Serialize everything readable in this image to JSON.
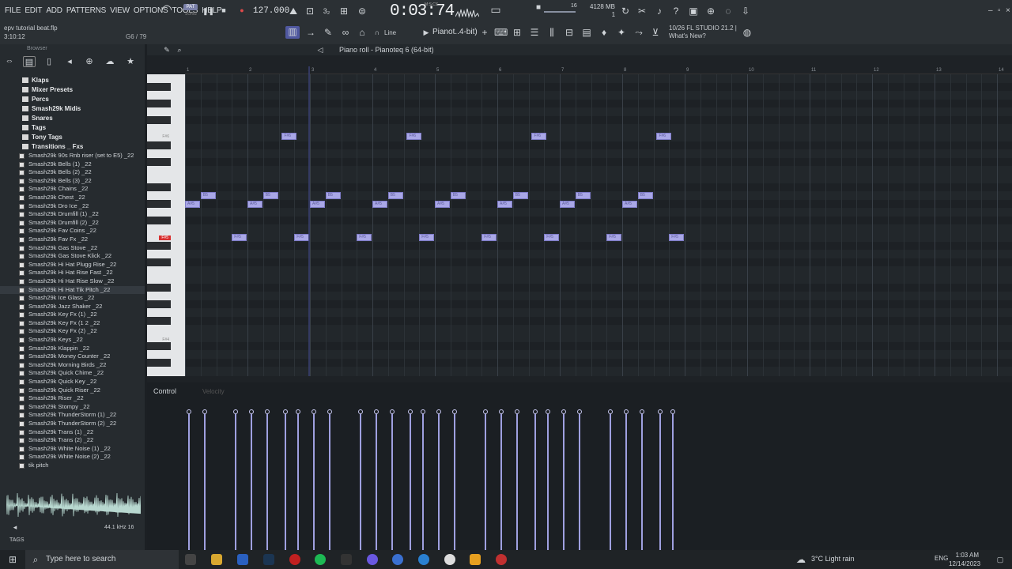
{
  "menu": {
    "items": [
      "FILE",
      "EDIT",
      "ADD",
      "PATTERNS",
      "VIEW",
      "OPTIONS",
      "TOOLS",
      "HELP"
    ]
  },
  "project": {
    "name": "epv tutorial beat.flp",
    "time": "3:10:12",
    "pattern": "G6 / 79"
  },
  "transport": {
    "mode_pat": "PAT",
    "mode_song": "SONG",
    "tempo": "127.000",
    "time": "0:03:74",
    "time_unit": "M:S:CS",
    "step": "3₂"
  },
  "cpu": {
    "memory": "4128 MB",
    "poly": "16",
    "cpu_val": "1"
  },
  "news": {
    "line1": "10/26  FL STUDIO 21.2 |",
    "line2": "What's New?"
  },
  "toolbar": {
    "snap": "Line",
    "channel": "Pianot..4-bit)"
  },
  "browser": {
    "title": "Browser",
    "folders": [
      "Klaps",
      "Mixer Presets",
      "Percs",
      "Smash29k Midis",
      "Snares",
      "Tags",
      "Tony Tags",
      "Transitions _ Fxs"
    ],
    "files": [
      "Smash29k 90s Rnb riser (set to E5) _22",
      "Smash29k Bells (1) _22",
      "Smash29k Bells (2) _22",
      "Smash29k Bells (3) _22",
      "Smash29k Chains _22",
      "Smash29k Chest _22",
      "Smash29k Dro Ice _22",
      "Smash29k Drumfill (1) _22",
      "Smash29k Drumfill (2) _22",
      "Smash29k Fav Coins _22",
      "Smash29k Fav Fx _22",
      "Smash29k Gas Stove _22",
      "Smash29k Gas Stove Klick _22",
      "Smash29k Hi Hat Plugg Rise _22",
      "Smash29k Hi Hat Rise Fast _22",
      "Smash29k Hi Hat Rise Slow _22",
      "Smash29k Hi Hat Tik Pitch _22",
      "Smash29k Ice Glass _22",
      "Smash29k Jazz Shaker _22",
      "Smash29k Key Fx (1) _22",
      "Smash29k Key Fx (1 2 _22",
      "Smash29k Key Fx (2) _22",
      "Smash29k Keys _22",
      "Smash29k Klappin _22",
      "Smash29k Money Counter _22",
      "Smash29k Morning Birds _22",
      "Smash29k Quick Chime _22",
      "Smash29k Quick Key _22",
      "Smash29k Quick Riser _22",
      "Smash29k Riser _22",
      "Smash29k Stompy _22",
      "Smash29k ThunderStorm (1) _22",
      "Smash29k ThunderStorm (2) _22",
      "Smash29k Trans (1) _22",
      "Smash29k Trans (2) _22",
      "Smash29k White Noise (1) _22",
      "Smash29k White Noise (2) _22",
      "tik pitch"
    ],
    "selected_index": 16,
    "sample_rate": "44.1 kHz 16",
    "tags_label": "TAGS"
  },
  "piano_roll": {
    "title": "Piano roll - Pianoteq 6 (64-bit)",
    "ruler": [
      "1",
      "2",
      "3",
      "4",
      "5",
      "6",
      "7",
      "8",
      "9",
      "10",
      "11",
      "12",
      "13",
      "14"
    ],
    "key_labels": [
      "F#6",
      "F#5",
      "F#4"
    ],
    "notes": [
      {
        "label": "F#6",
        "bar": 2.55
      },
      {
        "label": "F#6",
        "bar": 4.55
      },
      {
        "label": "F#6",
        "bar": 6.55
      },
      {
        "label": "F#6",
        "bar": 8.55
      },
      {
        "label": "B5",
        "bar": 1.25
      },
      {
        "label": "B5",
        "bar": 2.25
      },
      {
        "label": "B5",
        "bar": 3.25
      },
      {
        "label": "B5",
        "bar": 4.25
      },
      {
        "label": "B5",
        "bar": 5.25
      },
      {
        "label": "B5",
        "bar": 6.25
      },
      {
        "label": "B5",
        "bar": 7.25
      },
      {
        "label": "B5",
        "bar": 8.25
      },
      {
        "label": "A#5",
        "bar": 1.0
      },
      {
        "label": "A#5",
        "bar": 2.0
      },
      {
        "label": "A#5",
        "bar": 3.0
      },
      {
        "label": "A#5",
        "bar": 4.0
      },
      {
        "label": "A#5",
        "bar": 5.0
      },
      {
        "label": "A#5",
        "bar": 6.0
      },
      {
        "label": "A#5",
        "bar": 7.0
      },
      {
        "label": "A#5",
        "bar": 8.0
      },
      {
        "label": "F#5",
        "bar": 1.75
      },
      {
        "label": "F#5",
        "bar": 2.75
      },
      {
        "label": "F#5",
        "bar": 3.75
      },
      {
        "label": "F#5",
        "bar": 4.75
      },
      {
        "label": "F#5",
        "bar": 5.75
      },
      {
        "label": "F#5",
        "bar": 6.75
      },
      {
        "label": "F#5",
        "bar": 7.75
      },
      {
        "label": "F#5",
        "bar": 8.75
      }
    ],
    "control_label": "Control",
    "control_param": "Velocity"
  },
  "taskbar": {
    "search_placeholder": "Type here to search",
    "weather": "3°C  Light rain",
    "lang": "ENG",
    "time": "1:03 AM",
    "date": "12/14/2023"
  }
}
